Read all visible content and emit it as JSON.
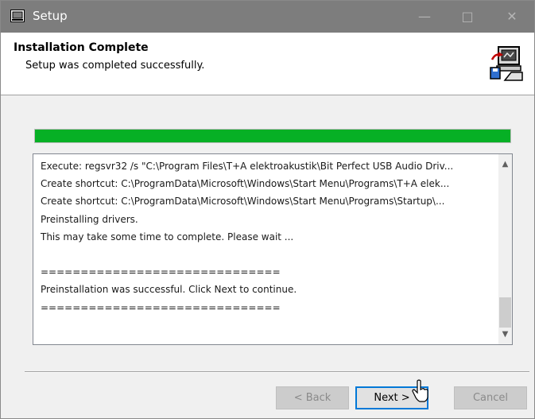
{
  "window": {
    "title": "Setup",
    "controls": {
      "minimize": "—",
      "maximize": "□",
      "close": "✕"
    }
  },
  "header": {
    "title": "Installation Complete",
    "subtitle": "Setup was completed successfully.",
    "icon": "setup-installer-icon"
  },
  "progress": {
    "fraction": 1.0,
    "color": "#06b025"
  },
  "log": {
    "lines": [
      "Execute: regsvr32 /s \"C:\\Program Files\\T+A elektroakustik\\Bit Perfect USB Audio Driv...",
      "Create shortcut: C:\\ProgramData\\Microsoft\\Windows\\Start Menu\\Programs\\T+A elek...",
      "Create shortcut: C:\\ProgramData\\Microsoft\\Windows\\Start Menu\\Programs\\Startup\\...",
      "Preinstalling drivers.",
      "This may take some time to complete. Please wait ...",
      "",
      "==============================",
      "Preinstallation was successful. Click Next to continue.",
      "=============================="
    ],
    "scroll_up": "▲",
    "scroll_down": "▼"
  },
  "buttons": {
    "back": "< Back",
    "next": "Next >",
    "cancel": "Cancel"
  }
}
